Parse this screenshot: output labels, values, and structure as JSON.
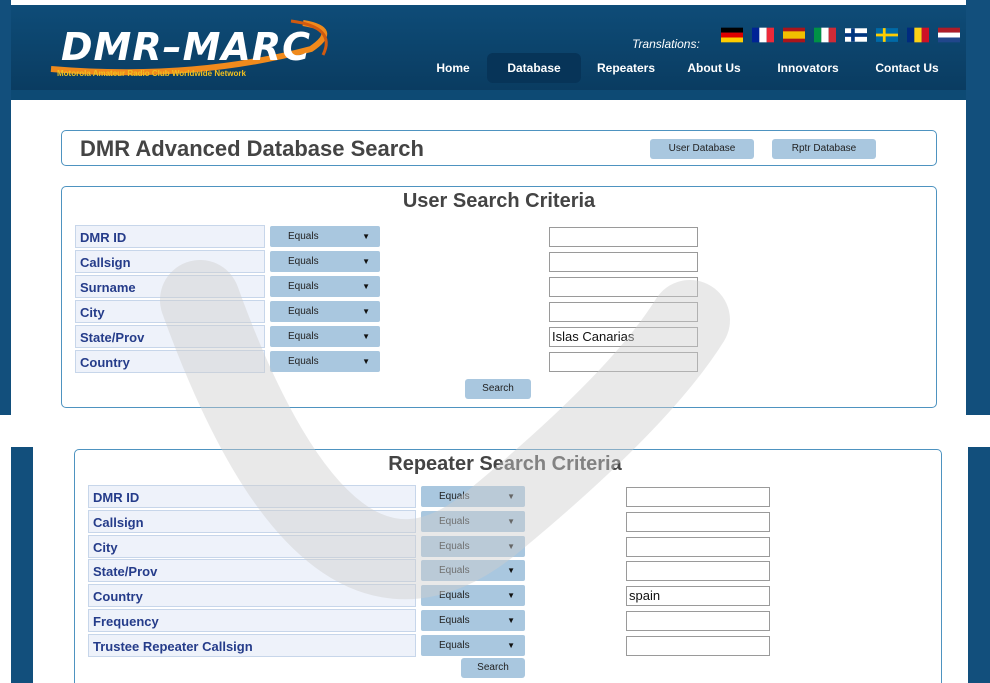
{
  "header": {
    "logo_text": "DMR–MARC",
    "logo_tagline": "Motorola Amateur Radio Club Worldwide Network",
    "translations_label": "Translations:",
    "flags": [
      {
        "icon": "germany-flag-icon",
        "colors": [
          "#000000",
          "#dd0000",
          "#ffce00"
        ]
      },
      {
        "icon": "france-flag-icon",
        "colors": [
          "#002395",
          "#ffffff",
          "#ed2939"
        ]
      },
      {
        "icon": "spain-flag-icon",
        "colors": [
          "#aa151b",
          "#f1bf00",
          "#aa151b"
        ]
      },
      {
        "icon": "italy-flag-icon",
        "colors": [
          "#009246",
          "#ffffff",
          "#ce2b37"
        ]
      },
      {
        "icon": "finland-flag-icon",
        "colors": [
          "#ffffff",
          "#003580"
        ]
      },
      {
        "icon": "sweden-flag-icon",
        "colors": [
          "#006aa7",
          "#fecc00"
        ]
      },
      {
        "icon": "romania-flag-icon",
        "colors": [
          "#002b7f",
          "#fcd116",
          "#ce1126"
        ]
      },
      {
        "icon": "netherlands-flag-icon",
        "colors": [
          "#ae1c28",
          "#ffffff",
          "#21468b"
        ]
      }
    ],
    "nav": [
      "Home",
      "Database",
      "Repeaters",
      "About Us",
      "Innovators",
      "Contact Us"
    ],
    "active_nav": "Database"
  },
  "advanced": {
    "title": "DMR Advanced Database Search",
    "user_db_button": "User Database",
    "rptr_db_button": "Rptr Database"
  },
  "user_search": {
    "title": "User Search Criteria",
    "rows": [
      {
        "label": "DMR ID",
        "op": "Equals",
        "value": ""
      },
      {
        "label": "Callsign",
        "op": "Equals",
        "value": ""
      },
      {
        "label": "Surname",
        "op": "Equals",
        "value": ""
      },
      {
        "label": "City",
        "op": "Equals",
        "value": ""
      },
      {
        "label": "State/Prov",
        "op": "Equals",
        "value": "Islas Canarias"
      },
      {
        "label": "Country",
        "op": "Equals",
        "value": ""
      }
    ],
    "search_button": "Search"
  },
  "repeater_search": {
    "title": "Repeater Search Criteria",
    "rows": [
      {
        "label": "DMR ID",
        "op": "Equals",
        "value": ""
      },
      {
        "label": "Callsign",
        "op": "Equals",
        "value": ""
      },
      {
        "label": "City",
        "op": "Equals",
        "value": ""
      },
      {
        "label": "State/Prov",
        "op": "Equals",
        "value": ""
      },
      {
        "label": "Country",
        "op": "Equals",
        "value": "spain"
      },
      {
        "label": "Frequency",
        "op": "Equals",
        "value": ""
      },
      {
        "label": "Trustee Repeater Callsign",
        "op": "Equals",
        "value": ""
      }
    ],
    "search_button": "Search"
  },
  "colors": {
    "brand_blue": "#124f7c",
    "panel_border": "#4e93c0",
    "button_fill": "#a9c7df",
    "label_text": "#253c8a",
    "logo_orange": "#f08a1c"
  }
}
